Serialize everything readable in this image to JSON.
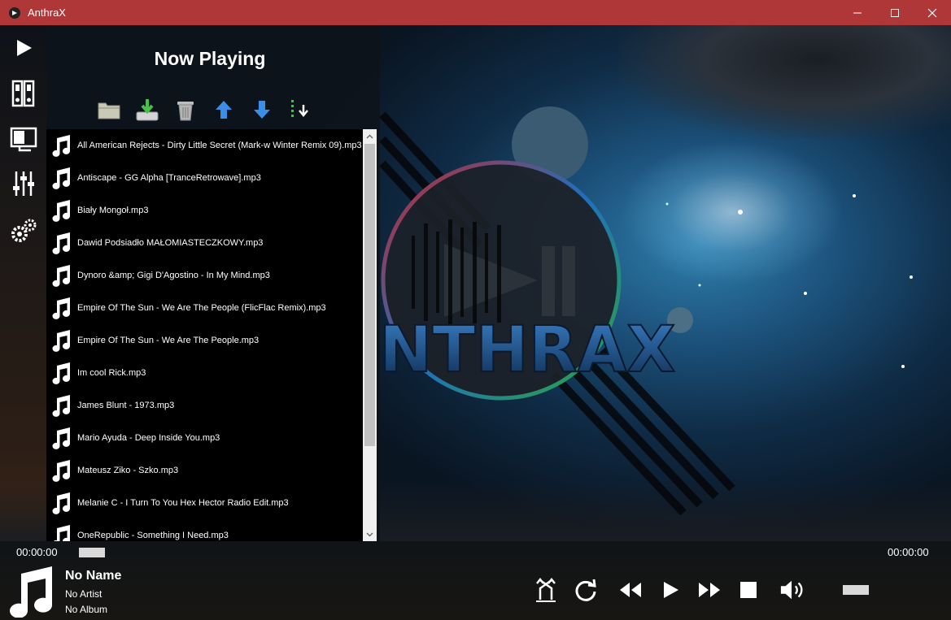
{
  "window": {
    "title": "AnthraX",
    "controls": [
      "minimize",
      "maximize",
      "close"
    ]
  },
  "sidebar": {
    "items": [
      {
        "name": "now-playing",
        "icon": "play-icon"
      },
      {
        "name": "library",
        "icon": "library-icon"
      },
      {
        "name": "visualizer",
        "icon": "monitor-icon"
      },
      {
        "name": "equalizer",
        "icon": "equalizer-icon"
      },
      {
        "name": "settings",
        "icon": "gears-icon"
      }
    ]
  },
  "panel": {
    "heading": "Now Playing",
    "toolbar": [
      {
        "name": "open-folder",
        "icon": "folder-icon"
      },
      {
        "name": "save-playlist",
        "icon": "download-icon"
      },
      {
        "name": "delete-track",
        "icon": "trash-icon"
      },
      {
        "name": "move-up",
        "icon": "arrow-up-icon"
      },
      {
        "name": "move-down",
        "icon": "arrow-down-icon"
      },
      {
        "name": "sort",
        "icon": "sort-icon"
      }
    ]
  },
  "playlist": {
    "tracks": [
      "All American Rejects - Dirty Little Secret (Mark-w Winter Remix 09).mp3",
      "Antiscape - GG Alpha [TranceRetrowave].mp3",
      "Biały Mongoł.mp3",
      "Dawid Podsiadło MAŁOMIASTECZKOWY.mp3",
      "Dynoro &amp; Gigi D'Agostino - In My Mind.mp3",
      "Empire Of The Sun - We Are The People (FlicFlac Remix).mp3",
      "Empire Of The Sun - We Are The People.mp3",
      "Im cool Rick.mp3",
      "James Blunt - 1973.mp3",
      "Mario Ayuda - Deep Inside You.mp3",
      "Mateusz Ziko - Szko.mp3",
      "Melanie C - I Turn To You Hex Hector Radio Edit.mp3",
      "OneRepublic - Something I Need.mp3"
    ]
  },
  "logo": {
    "text": "ANTHRAX",
    "colors": {
      "red": "#c1272d",
      "green": "#2da83a",
      "blue": "#1e6fbf"
    }
  },
  "player": {
    "elapsed": "00:00:00",
    "total": "00:00:00",
    "seek_fraction": 0,
    "volume_fraction": 1,
    "track": {
      "name": "No Name",
      "artist": "No Artist",
      "album": "No Album"
    },
    "controls": [
      "shuffle",
      "repeat",
      "previous",
      "play",
      "next",
      "stop",
      "volume"
    ]
  },
  "colors": {
    "titlebar": "#b03738",
    "panel": "#0e131a",
    "accent_blue": "#3a8ee6",
    "accent_green": "#43c247"
  }
}
